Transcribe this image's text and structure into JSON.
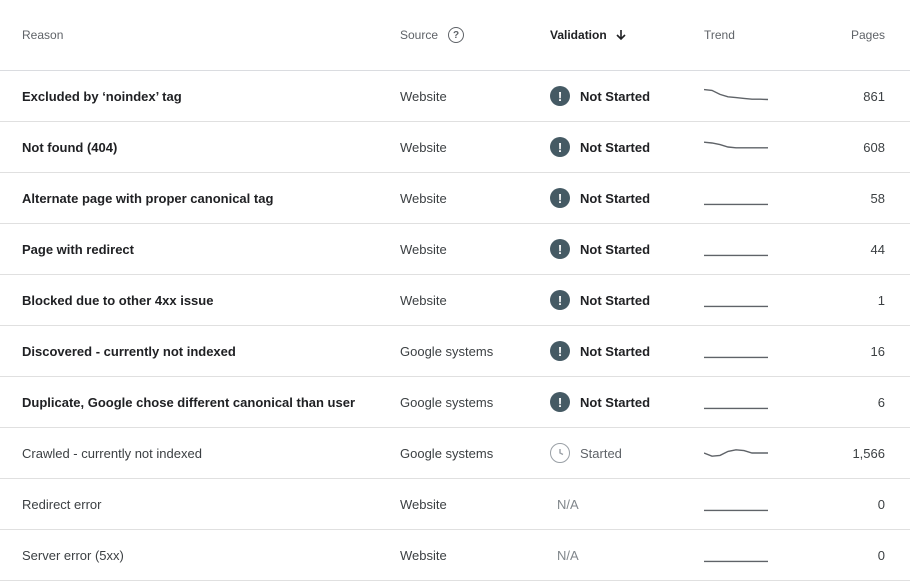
{
  "headers": {
    "reason": "Reason",
    "source": "Source",
    "validation": "Validation",
    "trend": "Trend",
    "pages": "Pages"
  },
  "colors": {
    "error_icon": "#455a64",
    "trend_line": "#5f6368"
  },
  "rows": [
    {
      "reason": "Excluded by ‘noindex’ tag",
      "source": "Website",
      "validation": "Not Started",
      "status": "error",
      "pages": "861",
      "trend": [
        0.9,
        0.85,
        0.6,
        0.45,
        0.4,
        0.35,
        0.3,
        0.3,
        0.28
      ]
    },
    {
      "reason": "Not found (404)",
      "source": "Website",
      "validation": "Not Started",
      "status": "error",
      "pages": "608",
      "trend": [
        0.8,
        0.75,
        0.65,
        0.5,
        0.45,
        0.45,
        0.45,
        0.45,
        0.45
      ]
    },
    {
      "reason": "Alternate page with proper canonical tag",
      "source": "Website",
      "validation": "Not Started",
      "status": "error",
      "pages": "58",
      "trend": [
        0.1,
        0.1,
        0.1,
        0.1,
        0.1,
        0.1,
        0.1,
        0.1,
        0.1
      ]
    },
    {
      "reason": "Page with redirect",
      "source": "Website",
      "validation": "Not Started",
      "status": "error",
      "pages": "44",
      "trend": [
        0.1,
        0.1,
        0.1,
        0.1,
        0.1,
        0.1,
        0.1,
        0.1,
        0.1
      ]
    },
    {
      "reason": "Blocked due to other 4xx issue",
      "source": "Website",
      "validation": "Not Started",
      "status": "error",
      "pages": "1",
      "trend": [
        0.1,
        0.1,
        0.1,
        0.1,
        0.1,
        0.1,
        0.1,
        0.1,
        0.1
      ]
    },
    {
      "reason": "Discovered - currently not indexed",
      "source": "Google systems",
      "validation": "Not Started",
      "status": "error",
      "pages": "16",
      "trend": [
        0.1,
        0.1,
        0.1,
        0.1,
        0.1,
        0.1,
        0.1,
        0.1,
        0.1
      ]
    },
    {
      "reason": "Duplicate, Google chose different canonical than user",
      "source": "Google systems",
      "validation": "Not Started",
      "status": "error",
      "pages": "6",
      "trend": [
        0.1,
        0.1,
        0.1,
        0.1,
        0.1,
        0.1,
        0.1,
        0.1,
        0.1
      ]
    },
    {
      "reason": "Crawled - currently not indexed",
      "source": "Google systems",
      "validation": "Started",
      "status": "started",
      "pages": "1,566",
      "trend": [
        0.5,
        0.3,
        0.35,
        0.6,
        0.7,
        0.65,
        0.5,
        0.5,
        0.5
      ]
    },
    {
      "reason": "Redirect error",
      "source": "Website",
      "validation": "N/A",
      "status": "na",
      "pages": "0",
      "trend": [
        0.1,
        0.1,
        0.1,
        0.1,
        0.1,
        0.1,
        0.1,
        0.1,
        0.1
      ]
    },
    {
      "reason": "Server error (5xx)",
      "source": "Website",
      "validation": "N/A",
      "status": "na",
      "pages": "0",
      "trend": [
        0.1,
        0.1,
        0.1,
        0.1,
        0.1,
        0.1,
        0.1,
        0.1,
        0.1
      ]
    }
  ]
}
